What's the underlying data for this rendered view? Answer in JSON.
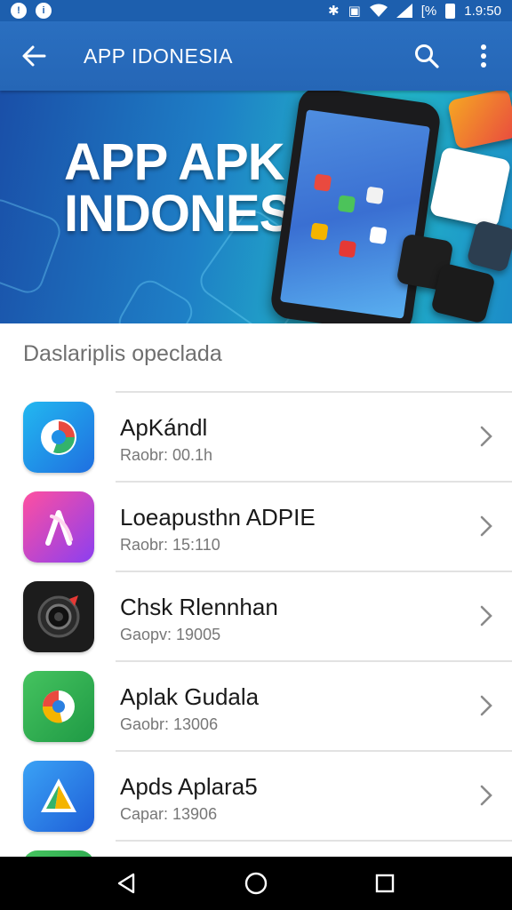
{
  "status_bar": {
    "left_icons": [
      "notification-icon",
      "notification-icon"
    ],
    "battery_text": "[%",
    "time": "1.9:50"
  },
  "app_bar": {
    "back_icon": "arrow-left-icon",
    "title": "APP IDONESIA",
    "search_icon": "search-icon",
    "more_icon": "more-vert-icon"
  },
  "banner": {
    "line1": "APP APK",
    "line2": "INDONESIA"
  },
  "section": {
    "header": "Daslariplis opeclada"
  },
  "apps": [
    {
      "name": "ApKándl",
      "meta": "Raobr: 00.1h",
      "icon": "app-icon-blue-swirl",
      "color": "#1f8fe6"
    },
    {
      "name": "Loeapusthn ADPIE",
      "meta": "Raobr: 15:110",
      "icon": "app-icon-magenta",
      "color": "#b43fd6"
    },
    {
      "name": "Chsk Rlennhan",
      "meta": "Gaopv: 19005",
      "icon": "app-icon-camera",
      "color": "#1c1c1c"
    },
    {
      "name": "Aplak Gudala",
      "meta": "Gaobr: 13006",
      "icon": "app-icon-green",
      "color": "#2fa84f"
    },
    {
      "name": "Apds Aplara5",
      "meta": "Capar: 13906",
      "icon": "app-icon-blue-triangle",
      "color": "#2a7fe0"
    }
  ],
  "nav_bar": {
    "back": "nav-back-icon",
    "home": "nav-home-icon",
    "recents": "nav-recents-icon"
  },
  "colors": {
    "primary": "#2566b6",
    "status_bar": "#1d5fae"
  }
}
